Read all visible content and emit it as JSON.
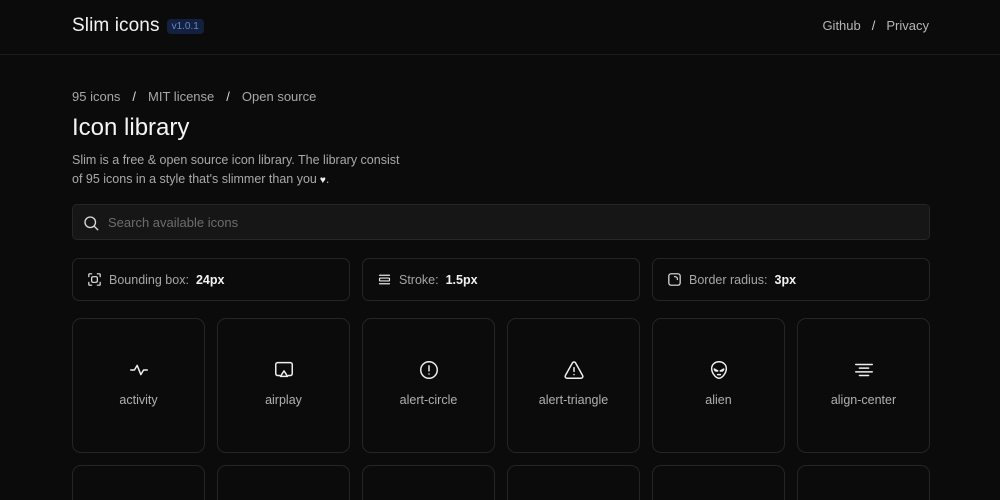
{
  "header": {
    "brand": "Slim icons",
    "version": "v1.0.1",
    "nav": [
      {
        "label": "Github"
      },
      {
        "label": "Privacy"
      }
    ],
    "nav_separator": "/"
  },
  "meta": {
    "items": [
      "95 icons",
      "MIT license",
      "Open source"
    ],
    "separator": "/"
  },
  "page": {
    "title": "Icon library",
    "description_line1": "Slim is a free & open source icon library. The library consist",
    "description_line2": "of 95 icons in a style that's slimmer than you",
    "heart": "♥",
    "description_end": "."
  },
  "search": {
    "placeholder": "Search available icons",
    "value": "",
    "icon": "search-icon"
  },
  "settings": [
    {
      "label": "Bounding box:",
      "value": "24px",
      "icon": "bounding-box-icon"
    },
    {
      "label": "Stroke:",
      "value": "1.5px",
      "icon": "stroke-icon"
    },
    {
      "label": "Border radius:",
      "value": "3px",
      "icon": "border-radius-icon"
    }
  ],
  "icons": [
    {
      "name": "activity",
      "icon": "activity-icon"
    },
    {
      "name": "airplay",
      "icon": "airplay-icon"
    },
    {
      "name": "alert-circle",
      "icon": "alert-circle-icon"
    },
    {
      "name": "alert-triangle",
      "icon": "alert-triangle-icon"
    },
    {
      "name": "alien",
      "icon": "alien-icon"
    },
    {
      "name": "align-center",
      "icon": "align-center-icon"
    }
  ],
  "colors": {
    "background": "#0b0b0b",
    "card_border": "#252525",
    "badge_text": "#5f86d9",
    "badge_bg": "#13213d",
    "text_primary": "#f2f2f2",
    "text_muted": "#a8a8a8"
  }
}
